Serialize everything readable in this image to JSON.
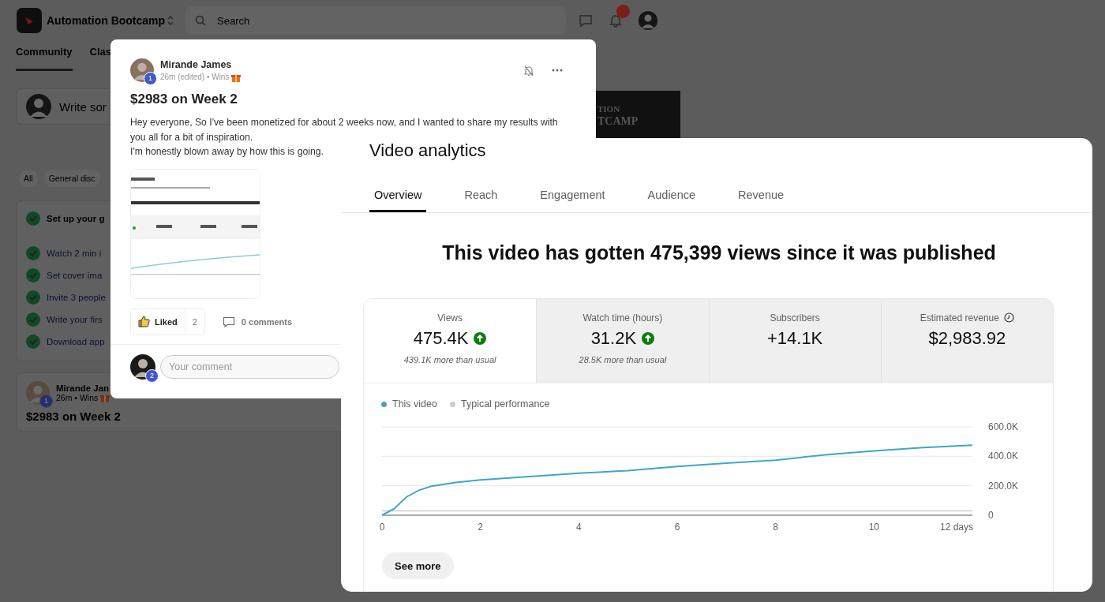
{
  "background": {
    "app_name": "Automation Bootcamp",
    "search": {
      "placeholder": "Search"
    },
    "tabs": [
      {
        "label": "Community",
        "selected": true
      },
      {
        "label": "Clas",
        "selected": false
      }
    ],
    "composer": {
      "placeholder": "Write sor"
    },
    "filters": [
      {
        "label": "All"
      },
      {
        "label": "General disc"
      }
    ],
    "checklist": {
      "title": "Set up your g",
      "checked": true,
      "items": [
        {
          "label": "Watch 2 min i",
          "checked": true
        },
        {
          "label": "Set cover ima",
          "checked": true
        },
        {
          "label": "Invite 3 people",
          "checked": true
        },
        {
          "label": "Write your firs",
          "checked": true
        },
        {
          "label": "Download app",
          "checked": true
        }
      ]
    },
    "banner": {
      "lines": [
        "TION",
        "TCAMP"
      ]
    },
    "feed_post": {
      "author": "Mirande Jan",
      "rank_badge": "1",
      "meta": "26m • Wins",
      "title": "$2983 on Week 2"
    }
  },
  "post": {
    "author": "Mirande James",
    "rank_badge": "1",
    "meta": "26m (edited) • Wins",
    "title": "$2983 on Week 2",
    "body": [
      "Hey everyone, So I've been monetized for about 2 weeks now, and I wanted to share my results with you all for a bit of inspiration.",
      "I'm honestly blown away by how this is going."
    ],
    "like": {
      "label": "Liked",
      "count": "2",
      "liked": true
    },
    "comments": "0 comments",
    "comment_field": {
      "placeholder": "Your comment",
      "rank_badge": "2"
    }
  },
  "analytics": {
    "title": "Video analytics",
    "tabs": [
      {
        "label": "Overview",
        "selected": true
      },
      {
        "label": "Reach",
        "selected": false
      },
      {
        "label": "Engagement",
        "selected": false
      },
      {
        "label": "Audience",
        "selected": false
      },
      {
        "label": "Revenue",
        "selected": false
      }
    ],
    "headline": "This video has gotten 475,399 views since it was published",
    "metrics": [
      {
        "label": "Views",
        "value": "475.4K",
        "trending_up": true,
        "note": "439.1K more than usual",
        "selected": true,
        "clock_icon": false
      },
      {
        "label": "Watch time (hours)",
        "value": "31.2K",
        "trending_up": true,
        "note": "28.5K more than usual",
        "selected": false,
        "clock_icon": false
      },
      {
        "label": "Subscribers",
        "value": "+14.1K",
        "trending_up": false,
        "selected": false,
        "clock_icon": false
      },
      {
        "label": "Estimated revenue",
        "value": "$2,983.92",
        "trending_up": false,
        "selected": false,
        "clock_icon": true
      }
    ],
    "chart_data": {
      "type": "line",
      "x": [
        0,
        0.25,
        0.5,
        0.75,
        1,
        1.5,
        2,
        3,
        4,
        5,
        6,
        7,
        8,
        9,
        10,
        11,
        12
      ],
      "series": [
        {
          "name": "This video",
          "color": "#3ea6c8",
          "values": [
            0,
            45000,
            125000,
            170000,
            197000,
            223000,
            240000,
            262000,
            285000,
            302000,
            331000,
            354000,
            374000,
            410000,
            436000,
            459000,
            475000
          ]
        },
        {
          "name": "Typical performance",
          "color": "#cccccc",
          "values": [
            30000,
            30000,
            30000,
            30000,
            30000,
            30000,
            30000,
            30000,
            30000,
            30000,
            30000,
            30000,
            30000,
            30000,
            30000,
            30000,
            30000
          ]
        }
      ],
      "xlim": [
        0,
        12
      ],
      "ylim": [
        0,
        600000
      ],
      "xticks": [
        0,
        2,
        4,
        6,
        8,
        10,
        {
          "value": 12,
          "label": "12 days"
        }
      ],
      "yticks": [
        0,
        {
          "value": 200000,
          "label": "200.0K"
        },
        {
          "value": 400000,
          "label": "400.0K"
        },
        {
          "value": 600000,
          "label": "600.0K"
        }
      ]
    },
    "see_more": "See more"
  }
}
